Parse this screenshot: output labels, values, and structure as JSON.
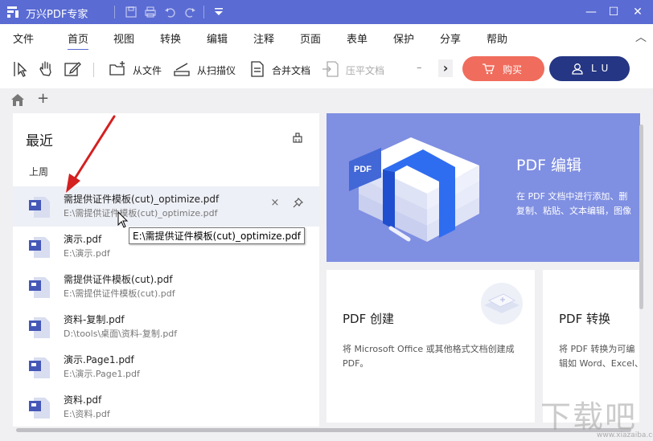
{
  "app": {
    "title": "万兴PDF专家"
  },
  "window": {
    "minimize": "—",
    "maximize": "☐",
    "close": "✕"
  },
  "menu": [
    "文件",
    "首页",
    "视图",
    "转换",
    "编辑",
    "注释",
    "页面",
    "表单",
    "保护",
    "分享",
    "帮助"
  ],
  "toolbar": {
    "from_file": "从文件",
    "from_scanner": "从扫描仪",
    "merge": "合并文档",
    "flatten": "压平文档",
    "more": "›",
    "buy": "购买",
    "user": "L U"
  },
  "tabs": {
    "add": "+"
  },
  "recent": {
    "title": "最近",
    "group": "上周",
    "files": [
      {
        "name": "需提供证件模板(cut)_optimize.pdf",
        "path": "E:\\需提供证件模板(cut)_optimize.pdf"
      },
      {
        "name": "演示.pdf",
        "path": "E:\\演示.pdf"
      },
      {
        "name": "需提供证件模板(cut).pdf",
        "path": "E:\\需提供证件模板(cut).pdf"
      },
      {
        "name": "资料-复制.pdf",
        "path": "D:\\tools\\桌面\\资料-复制.pdf"
      },
      {
        "name": "演示.Page1.pdf",
        "path": "E:\\演示.Page1.pdf"
      },
      {
        "name": "资料.pdf",
        "path": "E:\\资料.pdf"
      }
    ],
    "remove_glyph": "×",
    "tooltip": "E:\\需提供证件模板(cut)_optimize.pdf"
  },
  "hero": {
    "title": "PDF 编辑",
    "desc_line1": "在 PDF 文档中进行添加、删",
    "desc_line2": "复制、粘贴、文本编辑，图像",
    "badge": "PDF"
  },
  "cards": [
    {
      "title": "PDF 创建",
      "desc": "将 Microsoft Office 或其他格式文档创建成 PDF。"
    },
    {
      "title": "PDF 转换",
      "desc": "将 PDF 转换为可编辑如 Word、Excel、"
    }
  ],
  "watermark": {
    "main": "下载吧",
    "sub": "www.xiazaiba.com"
  },
  "colors": {
    "brand": "#5a6bd3",
    "buy": "#f06c5c",
    "user": "#253684",
    "hero": "#7f8fe2",
    "arrow": "#d42020"
  }
}
